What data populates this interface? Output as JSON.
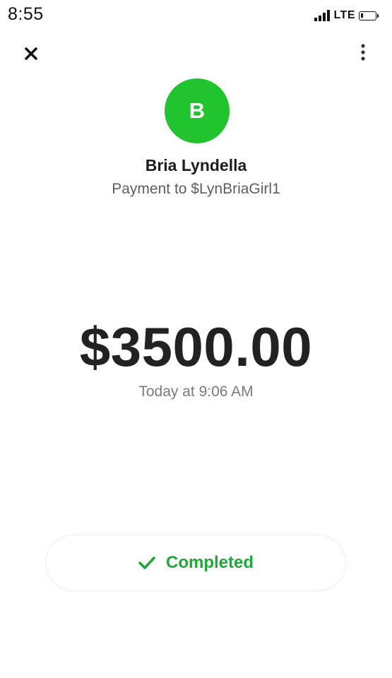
{
  "status_bar": {
    "time": "8:55",
    "network": "LTE",
    "signal_icon": "signal-icon",
    "battery_icon": "battery-icon"
  },
  "header": {
    "close_icon": "close-icon",
    "more_icon": "more-vertical-icon"
  },
  "recipient": {
    "initial": "B",
    "name": "Bria Lyndella",
    "subtitle": "Payment to $LynBriaGirl1",
    "avatar_color": "#21c42f"
  },
  "payment": {
    "amount": "$3500.00",
    "time": "Today at 9:06 AM"
  },
  "status": {
    "label": "Completed",
    "icon": "check-icon",
    "color": "#1ea83a"
  }
}
